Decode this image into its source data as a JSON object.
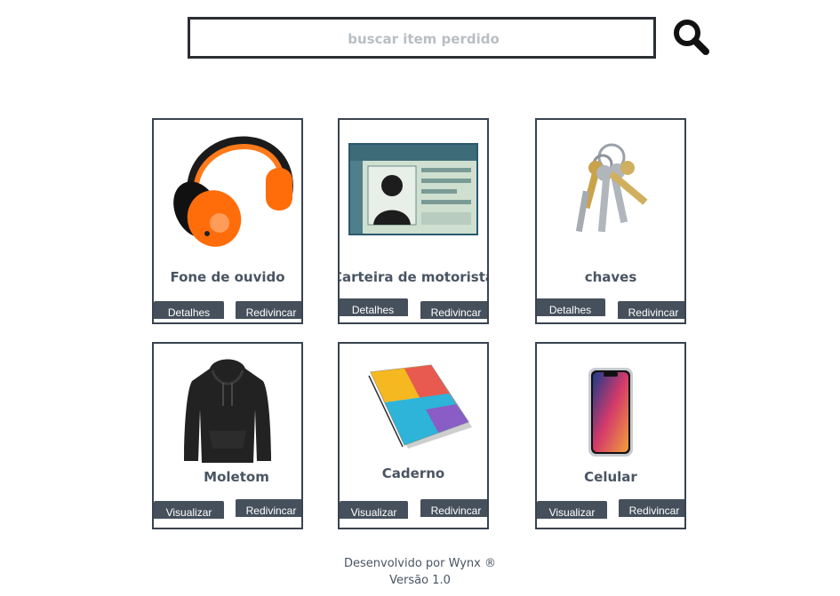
{
  "search": {
    "placeholder": "buscar item perdido",
    "icon": "search-icon"
  },
  "items": [
    {
      "title": "Fone de ouvido",
      "image": "headphones",
      "left_button": "Detalhes",
      "right_button": "Redivincar"
    },
    {
      "title": "Carteira de motorista",
      "image": "driver-license",
      "left_button": "Detalhes",
      "right_button": "Redivincar"
    },
    {
      "title": "chaves",
      "image": "keys",
      "left_button": "Detalhes",
      "right_button": "Redivincar"
    },
    {
      "title": "Moletom",
      "image": "hoodie",
      "left_button": "Visualizar",
      "right_button": "Redivincar"
    },
    {
      "title": "Caderno",
      "image": "notebook",
      "left_button": "Visualizar",
      "right_button": "Redivincar"
    },
    {
      "title": "Celular",
      "image": "smartphone",
      "left_button": "Visualizar",
      "right_button": "Redivincar"
    }
  ],
  "footer": {
    "line1": "Desenvolvido por Wynx ®",
    "line2": "Versão 1.0"
  },
  "colors": {
    "button_bg": "#46505c",
    "card_border": "#3a4350",
    "text": "#4a5563",
    "placeholder": "#b9bec4"
  }
}
